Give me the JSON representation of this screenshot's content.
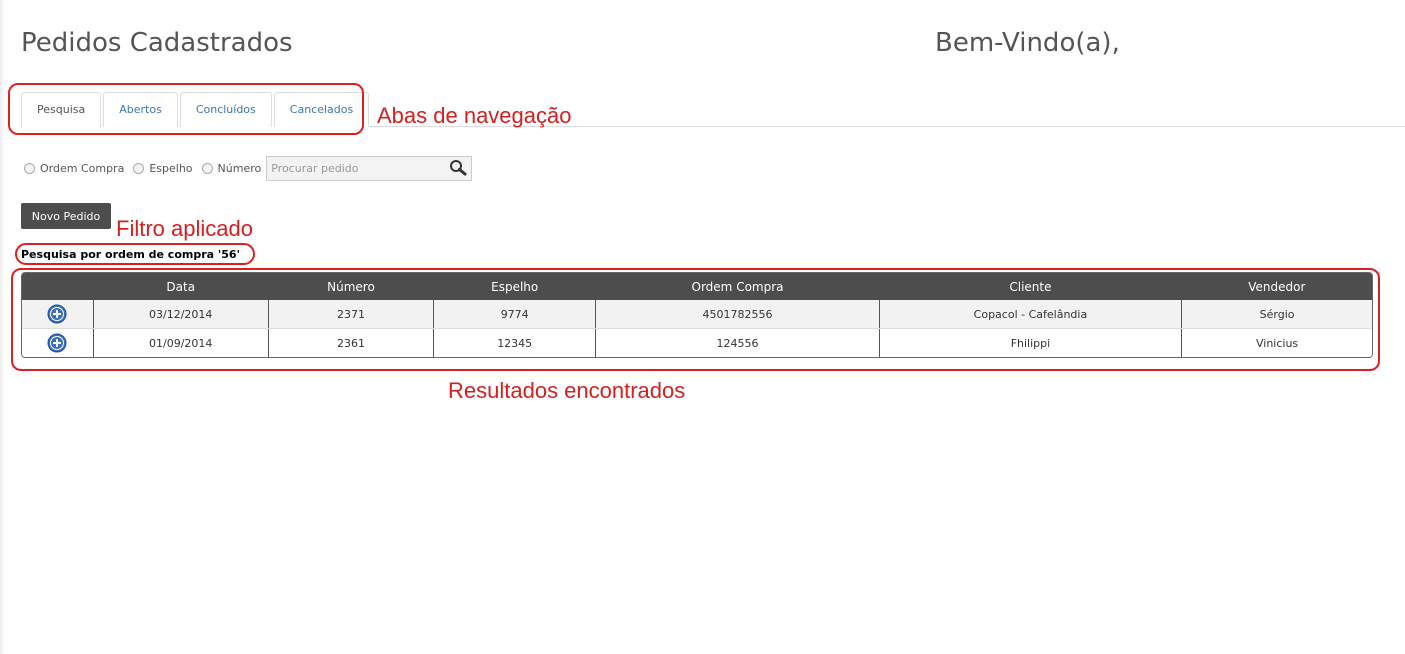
{
  "header": {
    "title": "Pedidos Cadastrados",
    "welcome": "Bem-Vindo(a),"
  },
  "tabs": [
    {
      "label": "Pesquisa",
      "active": true
    },
    {
      "label": "Abertos",
      "active": false
    },
    {
      "label": "Concluídos",
      "active": false
    },
    {
      "label": "Cancelados",
      "active": false
    }
  ],
  "filters": {
    "options": [
      "Ordem Compra",
      "Espelho",
      "Número"
    ],
    "search_placeholder": "Procurar pedido"
  },
  "actions": {
    "new_order": "Novo Pedido"
  },
  "filter_info": "Pesquisa por ordem de compra '56'",
  "table": {
    "columns": [
      "Data",
      "Número",
      "Espelho",
      "Ordem Compra",
      "Cliente",
      "Vendedor"
    ],
    "rows": [
      [
        "03/12/2014",
        "2371",
        "9774",
        "4501782556",
        "Copacol - Cafelândia",
        "Sérgio"
      ],
      [
        "01/09/2014",
        "2361",
        "12345",
        "124556",
        "Fhilippi",
        "Vinicius"
      ]
    ]
  },
  "annotations": {
    "tabs": "Abas de navegação",
    "filter": "Filtro aplicado",
    "results": "Resultados encontrados"
  },
  "colors": {
    "annotation": "#e02020",
    "header_bg": "#4d4d4d",
    "tab_link": "#3a78b5",
    "expand_icon": "#3a6fc4"
  },
  "icons": [
    "search-icon",
    "plus-circle-icon"
  ]
}
